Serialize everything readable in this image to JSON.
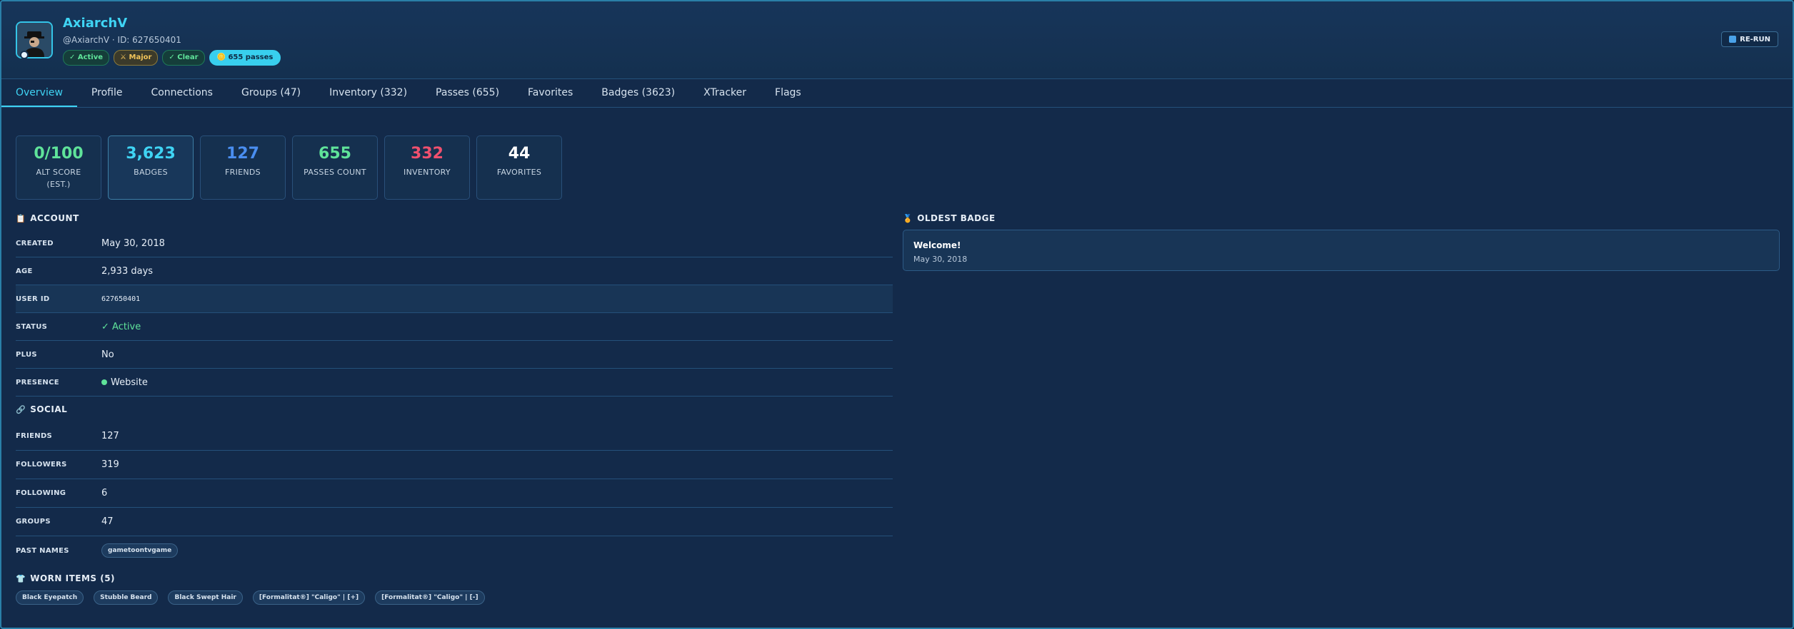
{
  "profile": {
    "username": "AxiarchV",
    "subline": "@AxiarchV · ID: 627650401",
    "pills": {
      "active": "✓ Active",
      "major": "⚔ Major",
      "clear": "✓ Clear",
      "passes": "🪙 655 passes"
    },
    "rerun_label": "RE-RUN"
  },
  "tabs": [
    {
      "label": "Overview"
    },
    {
      "label": "Profile"
    },
    {
      "label": "Connections"
    },
    {
      "label": "Groups (47)"
    },
    {
      "label": "Inventory (332)"
    },
    {
      "label": "Passes (655)"
    },
    {
      "label": "Favorites"
    },
    {
      "label": "Badges (3623)"
    },
    {
      "label": "XTracker"
    },
    {
      "label": "Flags"
    }
  ],
  "stats": [
    {
      "value": "0/100",
      "label": "ALT SCORE (EST.)",
      "color": "#5fe39a"
    },
    {
      "value": "3,623",
      "label": "BADGES",
      "color": "#3fd4f4"
    },
    {
      "value": "127",
      "label": "FRIENDS",
      "color": "#4a8ef0"
    },
    {
      "value": "655",
      "label": "PASSES COUNT",
      "color": "#5fe39a"
    },
    {
      "value": "332",
      "label": "INVENTORY",
      "color": "#f0506e"
    },
    {
      "value": "44",
      "label": "FAVORITES",
      "color": "#ffffff"
    }
  ],
  "account": {
    "title": "ACCOUNT",
    "rows": [
      {
        "key": "CREATED",
        "value": "May 30, 2018"
      },
      {
        "key": "AGE",
        "value": "2,933 days"
      },
      {
        "key": "USER ID",
        "value": "627650401"
      },
      {
        "key": "STATUS",
        "value": "✓ Active"
      },
      {
        "key": "PLUS",
        "value": "No"
      },
      {
        "key": "PRESENCE",
        "value": "Website"
      }
    ]
  },
  "social": {
    "title": "SOCIAL",
    "rows": [
      {
        "key": "FRIENDS",
        "value": "127"
      },
      {
        "key": "FOLLOWERS",
        "value": "319"
      },
      {
        "key": "FOLLOWING",
        "value": "6"
      },
      {
        "key": "GROUPS",
        "value": "47"
      },
      {
        "key": "PAST NAMES",
        "value": "gametoontvgame"
      }
    ]
  },
  "worn": {
    "title": "WORN ITEMS (5)",
    "items": [
      "Black Eyepatch",
      "Stubble Beard",
      "Black Swept Hair",
      "[Formalitat®] \"Caligo\" | [+]",
      "[Formalitat®] \"Caligo\" | [-]"
    ]
  },
  "oldest_badge": {
    "title": "OLDEST BADGE",
    "name": "Welcome!",
    "date": "May 30, 2018"
  }
}
